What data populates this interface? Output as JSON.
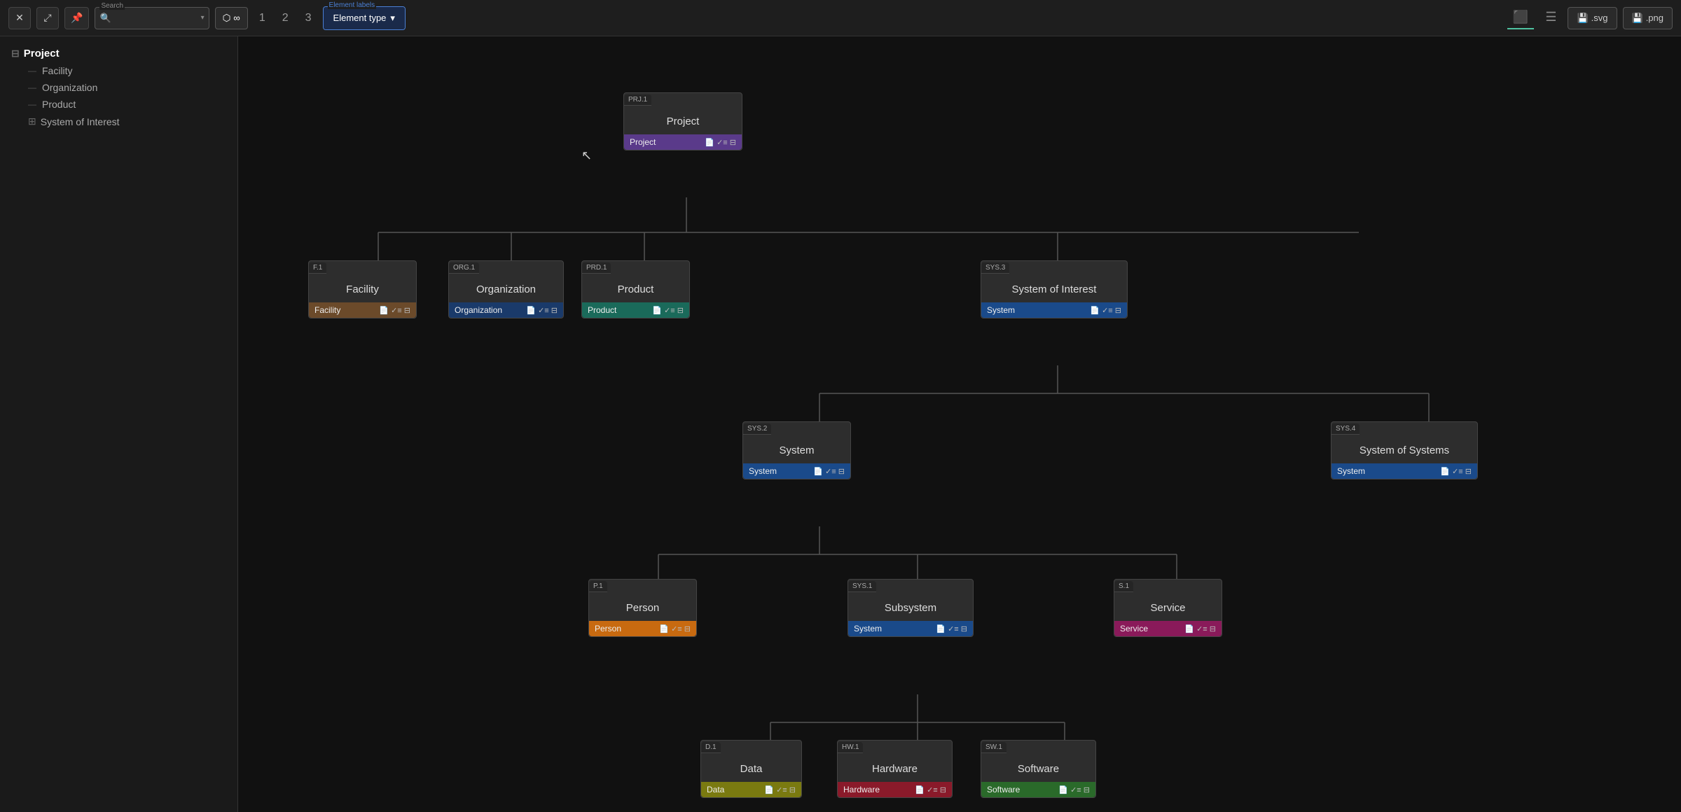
{
  "toolbar": {
    "close_label": "✕",
    "expand_label": "⤢",
    "pin_label": "📌",
    "search_placeholder": "",
    "search_label": "Search",
    "layers_label": "∞",
    "level1_label": "1",
    "level2_label": "2",
    "level3_label": "3",
    "element_labels_label": "Element labels",
    "element_type_label": "Element type",
    "chevron_down": "▾",
    "tree_view_icon": "⬛",
    "list_view_icon": "☰",
    "export_svg_label": ".svg",
    "export_png_label": ".png"
  },
  "sidebar": {
    "root_label": "Project",
    "items": [
      {
        "label": "Facility",
        "indent": "child"
      },
      {
        "label": "Organization",
        "indent": "child"
      },
      {
        "label": "Product",
        "indent": "child"
      },
      {
        "label": "System of Interest",
        "indent": "child",
        "expand": true
      }
    ]
  },
  "nodes": {
    "project": {
      "id": "PRJ.1",
      "title": "Project",
      "footer": "Project",
      "footer_class": "footer-purple"
    },
    "facility": {
      "id": "F.1",
      "title": "Facility",
      "footer": "Facility",
      "footer_class": "footer-brown"
    },
    "organization": {
      "id": "ORG.1",
      "title": "Organization",
      "footer": "Organization",
      "footer_class": "footer-darkblue"
    },
    "product": {
      "id": "PRD.1",
      "title": "Product",
      "footer": "Product",
      "footer_class": "footer-teal"
    },
    "system_of_interest": {
      "id": "SYS.3",
      "title": "System of Interest",
      "footer": "System",
      "footer_class": "footer-blue"
    },
    "system2": {
      "id": "SYS.2",
      "title": "System",
      "footer": "System",
      "footer_class": "footer-blue"
    },
    "system_of_systems": {
      "id": "SYS.4",
      "title": "System of Systems",
      "footer": "System",
      "footer_class": "footer-blue"
    },
    "person": {
      "id": "P.1",
      "title": "Person",
      "footer": "Person",
      "footer_class": "footer-orange"
    },
    "subsystem": {
      "id": "SYS.1",
      "title": "Subsystem",
      "footer": "System",
      "footer_class": "footer-blue"
    },
    "service": {
      "id": "S.1",
      "title": "Service",
      "footer": "Service",
      "footer_class": "footer-pink"
    },
    "data": {
      "id": "D.1",
      "title": "Data",
      "footer": "Data",
      "footer_class": "footer-yellow"
    },
    "hardware": {
      "id": "HW.1",
      "title": "Hardware",
      "footer": "Hardware",
      "footer_class": "footer-red"
    },
    "software": {
      "id": "SW.1",
      "title": "Software",
      "footer": "Software",
      "footer_class": "footer-green"
    }
  },
  "icons": {
    "doc": "📄",
    "check": "✓",
    "list": "≡",
    "expand": "⊞",
    "floppy": "💾"
  }
}
